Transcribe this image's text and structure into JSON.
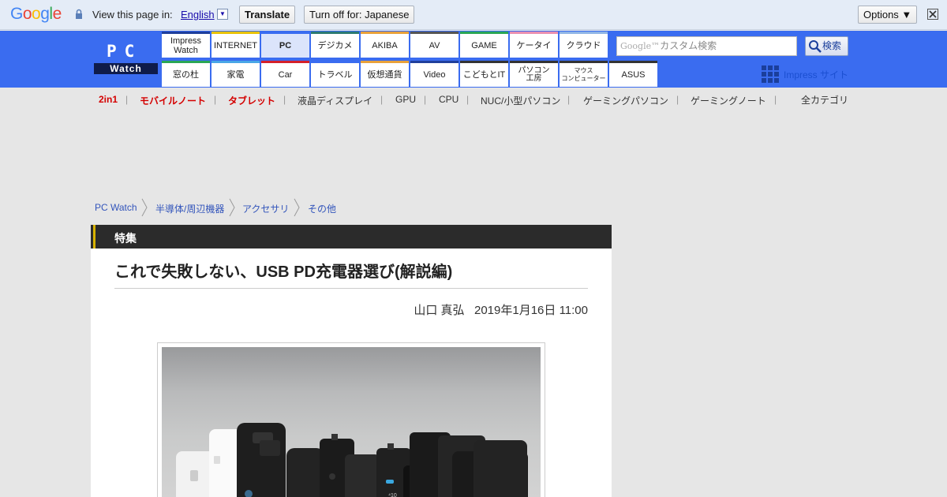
{
  "translate_bar": {
    "logo": "Google",
    "view_text": "View this page in:",
    "language": "English",
    "translate_button": "Translate",
    "turn_off_button": "Turn off for: Japanese",
    "options_button": "Options ▼"
  },
  "site": {
    "logo_top": "PC",
    "logo_bottom": "Watch"
  },
  "nav": {
    "top": [
      "Impress\nWatch",
      "INTERNET",
      "PC",
      "デジカメ",
      "AKIBA",
      "AV",
      "GAME",
      "ケータイ",
      "クラウド"
    ],
    "bottom": [
      "窓の杜",
      "家電",
      "Car",
      "トラベル",
      "仮想通貨",
      "Video",
      "こどもとIT",
      "パソコン\n工房",
      "マウス\nコンピューター",
      "ASUS"
    ],
    "active": "PC",
    "top_colors": [
      "#1f3f9c",
      "#e8c200",
      "#3a6cf0",
      "#2c7a72",
      "#e8a13a",
      "#555555",
      "#2aa655",
      "#e98fb1",
      "#8fb5e6"
    ],
    "bottom_colors": [
      "#2aa655",
      "#49a6e6",
      "#d4202a",
      "#3a6cf0",
      "#e8a13a",
      "#1f3f9c",
      "#333333",
      "#333333",
      "#333333",
      "#333333"
    ]
  },
  "search": {
    "placeholder_brand": "Google™",
    "placeholder": "カスタム検索",
    "button": "検索"
  },
  "impress_sites": "Impress サイト",
  "categories": {
    "items": [
      "2in1",
      "モバイルノート",
      "タブレット",
      "液晶ディスプレイ",
      "GPU",
      "CPU",
      "NUC/小型パソコン",
      "ゲーミングパソコン",
      "ゲーミングノート"
    ],
    "highlighted": [
      "2in1",
      "モバイルノート",
      "タブレット"
    ],
    "all": "全カテゴリ"
  },
  "breadcrumb": [
    "PC Watch",
    "半導体/周辺機器",
    "アクセサリ",
    "その他"
  ],
  "article": {
    "section": "特集",
    "title": "これで失敗しない、USB PD充電器選び(解説編)",
    "author": "山口 真弘",
    "date": "2019年1月16日 11:00"
  },
  "colors": {
    "header_blue": "#3a6cf0",
    "accent_red": "#d40000",
    "link": "#3355bb"
  }
}
